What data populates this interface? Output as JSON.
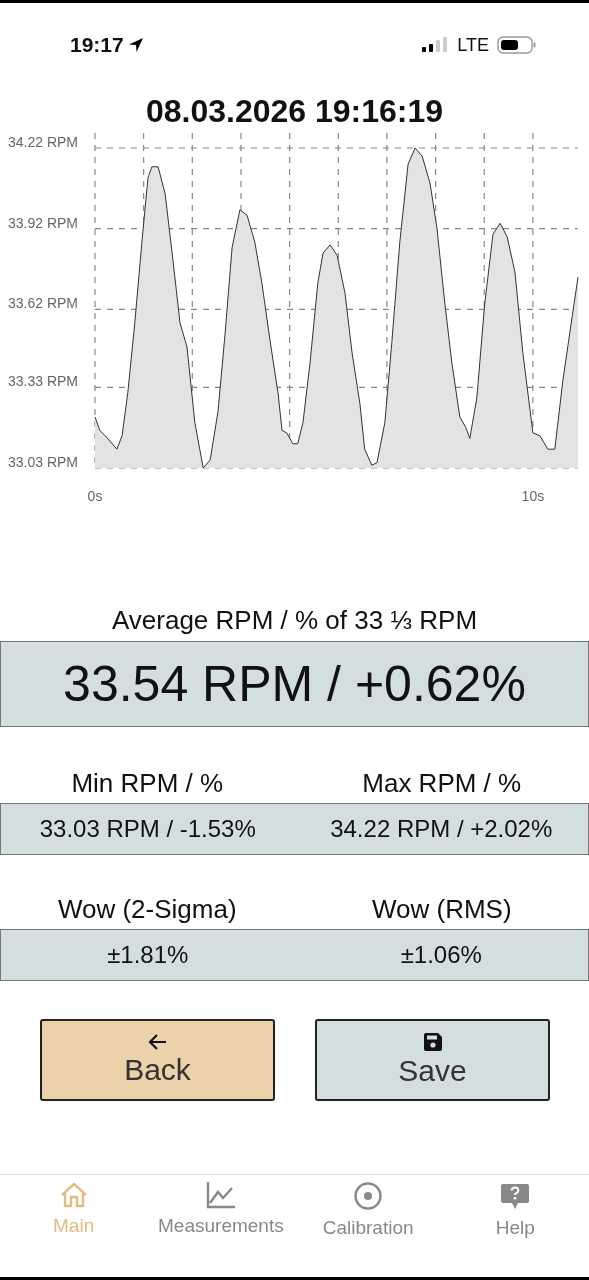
{
  "status_bar": {
    "time": "19:17",
    "network": "LTE"
  },
  "title": "08.03.2026 19:16:19",
  "chart": {
    "chart_data": {
      "type": "area",
      "x": [
        0,
        0.11,
        0.23,
        0.34,
        0.5,
        0.62,
        0.75,
        0.91,
        1.07,
        1.21,
        1.3,
        1.44,
        1.6,
        1.76,
        1.94,
        2.1,
        2.28,
        2.47,
        2.63,
        2.81,
        2.97,
        3.13,
        3.31,
        3.47,
        3.65,
        3.81,
        4.0,
        4.18,
        4.27,
        4.38,
        4.52,
        4.63,
        4.75,
        4.91,
        5.09,
        5.21,
        5.37,
        5.53,
        5.71,
        5.87,
        6.05,
        6.16,
        6.32,
        6.44,
        6.62,
        6.78,
        6.96,
        7.15,
        7.31,
        7.47,
        7.65,
        7.81,
        7.99,
        8.15,
        8.33,
        8.47,
        8.56,
        8.72,
        8.9,
        9.09,
        9.25,
        9.41,
        9.59,
        9.77,
        10.0,
        10.16,
        10.34,
        10.5,
        10.68,
        10.84,
        11.03
      ],
      "grid": true,
      "series": [
        {
          "color": "#e3e3e3",
          "values": [
            33.22,
            33.17,
            33.15,
            33.13,
            33.1,
            33.15,
            33.31,
            33.57,
            33.87,
            34.11,
            34.15,
            34.15,
            34.05,
            33.83,
            33.57,
            33.48,
            33.2,
            33.03,
            33.06,
            33.24,
            33.53,
            33.85,
            33.99,
            33.97,
            33.87,
            33.72,
            33.5,
            33.31,
            33.17,
            33.16,
            33.12,
            33.12,
            33.2,
            33.42,
            33.72,
            33.83,
            33.86,
            33.82,
            33.68,
            33.46,
            33.27,
            33.1,
            33.04,
            33.05,
            33.2,
            33.5,
            33.87,
            34.16,
            34.22,
            34.19,
            34.09,
            33.92,
            33.64,
            33.42,
            33.22,
            33.18,
            33.14,
            33.29,
            33.64,
            33.9,
            33.94,
            33.89,
            33.76,
            33.46,
            33.16,
            33.15,
            33.1,
            33.1,
            33.35,
            33.53,
            33.74
          ]
        }
      ],
      "xlim": [
        0,
        11.03
      ],
      "ylim": [
        33.03,
        34.22
      ],
      "xticks": [
        {
          "value": 0,
          "label": "0s"
        },
        {
          "value": 10,
          "label": "10s"
        }
      ],
      "yticks": [
        {
          "value": 34.22,
          "label": "34.22 RPM"
        },
        {
          "value": 33.92,
          "label": "33.92 RPM"
        },
        {
          "value": 33.62,
          "label": "33.62 RPM"
        },
        {
          "value": 33.33,
          "label": "33.33 RPM"
        },
        {
          "value": 33.03,
          "label": "33.03 RPM"
        }
      ]
    }
  },
  "average": {
    "label": "Average RPM / % of 33 ⅓ RPM",
    "value": "33.54 RPM / +0.62%"
  },
  "stat_rows": [
    {
      "items": [
        {
          "label": "Min RPM / %",
          "value": "33.03 RPM / -1.53%"
        },
        {
          "label": "Max RPM / %",
          "value": "34.22 RPM / +2.02%"
        }
      ]
    },
    {
      "items": [
        {
          "label": "Wow (2-Sigma)",
          "value": "±1.81%"
        },
        {
          "label": "Wow (RMS)",
          "value": "±1.06%"
        }
      ]
    }
  ],
  "buttons": [
    {
      "kind": "back",
      "label": "Back"
    },
    {
      "kind": "save",
      "label": "Save"
    }
  ],
  "tabs": [
    {
      "kind": "home",
      "label": "Main",
      "selected": true
    },
    {
      "kind": "chart",
      "label": "Measurements",
      "selected": false
    },
    {
      "kind": "target",
      "label": "Calibration",
      "selected": false
    },
    {
      "kind": "help",
      "label": "Help",
      "selected": false
    }
  ]
}
